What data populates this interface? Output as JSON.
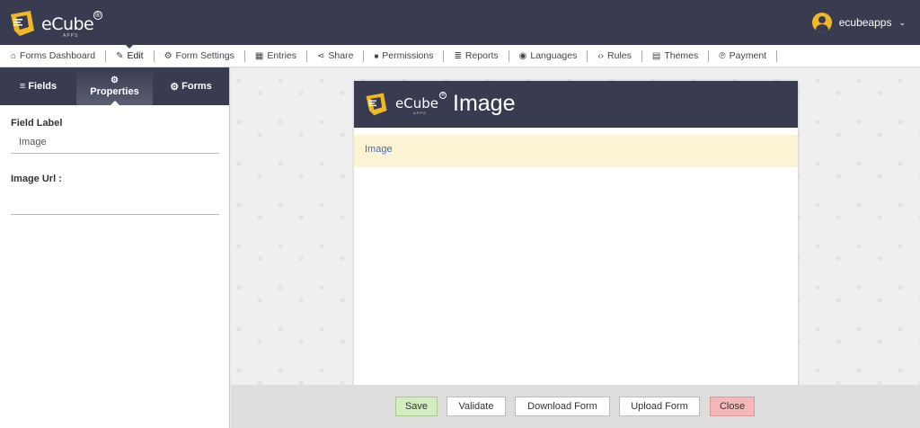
{
  "header": {
    "logo_text": "eCube",
    "logo_sub": "APPS",
    "logo_reg": "®",
    "username": "ecubeapps",
    "user_caret": "⌄"
  },
  "nav": {
    "items": [
      {
        "label": "Forms Dashboard",
        "icon": "home-icon",
        "glyph": "⌂"
      },
      {
        "label": "Edit",
        "icon": "edit-icon",
        "glyph": "✎"
      },
      {
        "label": "Form Settings",
        "icon": "gear-icon",
        "glyph": "⚙"
      },
      {
        "label": "Entries",
        "icon": "table-icon",
        "glyph": "▦"
      },
      {
        "label": "Share",
        "icon": "share-icon",
        "glyph": "⋖"
      },
      {
        "label": "Permissions",
        "icon": "lock-icon",
        "glyph": "🔒"
      },
      {
        "label": "Reports",
        "icon": "database-icon",
        "glyph": "≣"
      },
      {
        "label": "Languages",
        "icon": "globe-icon",
        "glyph": "◉"
      },
      {
        "label": "Rules",
        "icon": "code-icon",
        "glyph": "‹›"
      },
      {
        "label": "Themes",
        "icon": "keyboard-icon",
        "glyph": "▤"
      },
      {
        "label": "Payment",
        "icon": "paypal-icon",
        "glyph": "℗"
      }
    ],
    "active": "Edit"
  },
  "left_panel": {
    "tabs": [
      {
        "label": "Fields",
        "icon": "list-icon",
        "glyph": "≡"
      },
      {
        "label": "Properties",
        "icon": "cogs-icon",
        "glyph": "⚙"
      },
      {
        "label": "Forms",
        "icon": "gear-icon",
        "glyph": "⚙"
      }
    ],
    "active_tab": "Properties",
    "field_label_title": "Field Label",
    "field_label_value": "Image",
    "image_url_title": "Image Url :",
    "image_url_value": ""
  },
  "form": {
    "title": "Image",
    "field_label": "Image"
  },
  "footer": {
    "save": "Save",
    "validate": "Validate",
    "download": "Download Form",
    "upload": "Upload Form",
    "close": "Close"
  },
  "colors": {
    "header_bg": "#393c50",
    "accent_yellow": "#f2b824",
    "link_blue": "#3b6dc7"
  }
}
